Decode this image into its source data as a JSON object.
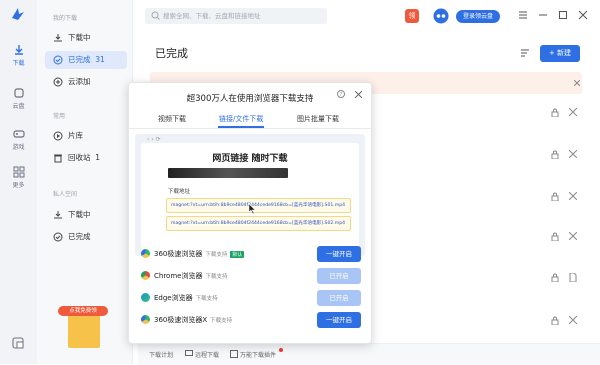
{
  "rail": {
    "items": [
      {
        "label": "下载"
      },
      {
        "label": "云盘"
      },
      {
        "label": "游戏"
      },
      {
        "label": "更多"
      }
    ]
  },
  "sidebar": {
    "section1": "我的下载",
    "items1": [
      {
        "label": "下载中",
        "count": ""
      },
      {
        "label": "已完成",
        "count": "31"
      },
      {
        "label": "云添加",
        "count": ""
      }
    ],
    "section2": "常用",
    "items2": [
      {
        "label": "片库",
        "count": ""
      },
      {
        "label": "回收站",
        "count": "1"
      }
    ],
    "section3": "私人空间",
    "items3": [
      {
        "label": "下载中",
        "count": ""
      },
      {
        "label": "已完成",
        "count": ""
      }
    ],
    "promo_text": "点我免费领"
  },
  "topbar": {
    "search_placeholder": "搜索全网、下载、云盘和链接地址",
    "gift_label": "领",
    "login_button": "登录领云盘"
  },
  "main": {
    "title": "已完成",
    "new_button": "+ 新建"
  },
  "bottom": {
    "plan": "下载计划",
    "remote": "远程下载",
    "plugin": "万能下载插件"
  },
  "overlay": {
    "title": "超300万人在使用浏览器下载支持",
    "tabs": [
      "视频下载",
      "链接/文件下载",
      "图片批量下载"
    ],
    "demo_title": "网页链接 随时下载",
    "address_label": "下载地址",
    "links": [
      "magnet:?xt=urn:btih:8b9ce4804f2444cede9168cb=[蓝光华语电影].S01.mp4",
      "magnet:?xt=urn:btih:8b9ce4804f2444cede9168cb=[蓝光华语电影].S02.mp4"
    ],
    "browsers": [
      {
        "name": "360极速浏览器",
        "desc": "下载支持",
        "badge": "默认",
        "button": "一键开启",
        "color": "#2fb86a"
      },
      {
        "name": "Chrome浏览器",
        "desc": "下载支持",
        "badge": "",
        "button": "已开启",
        "color": "#e8453c"
      },
      {
        "name": "Edge浏览器",
        "desc": "下载支持",
        "badge": "",
        "button": "已开启",
        "color": "#1d8fd8"
      },
      {
        "name": "360极速浏览器X",
        "desc": "下载支持",
        "badge": "",
        "button": "一键开启",
        "color": "#2fb86a"
      }
    ]
  },
  "colors": {
    "accent": "#2f6fe4",
    "notice_bg": "#fdf0e9"
  }
}
